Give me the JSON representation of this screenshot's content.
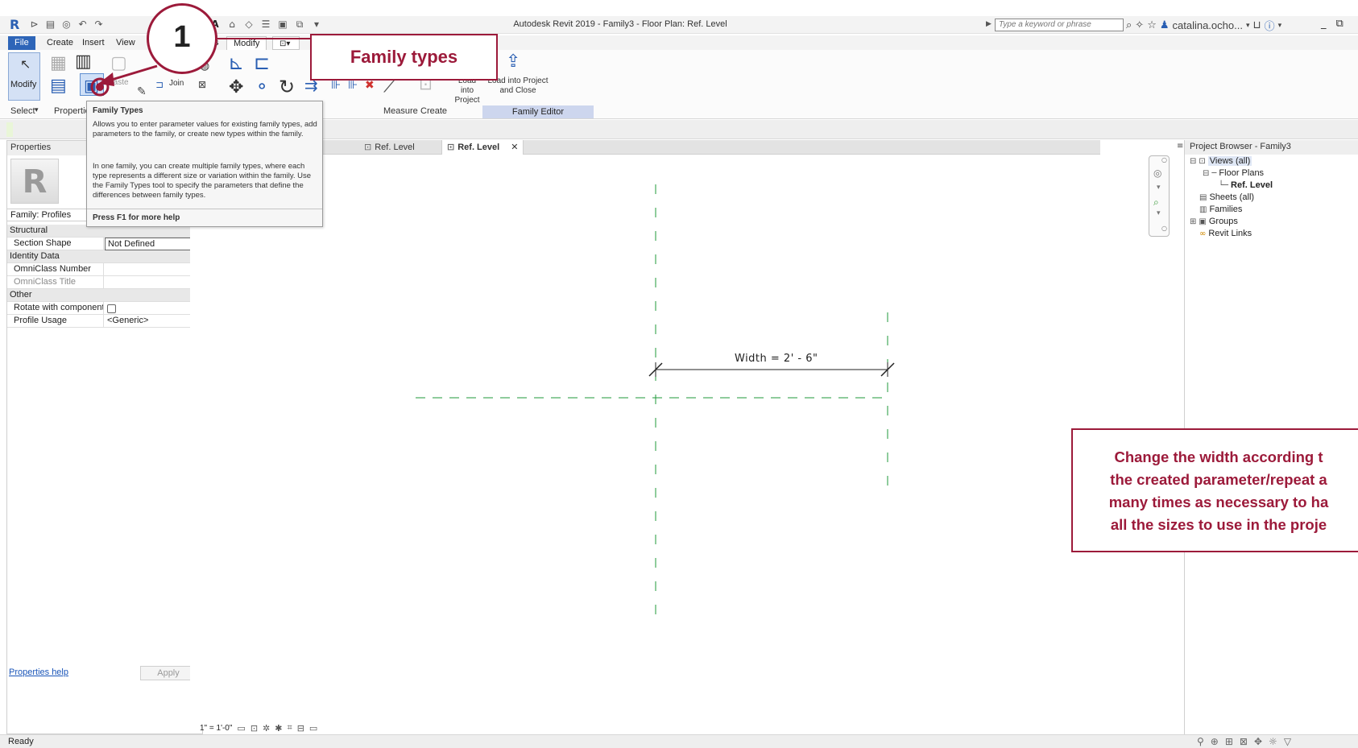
{
  "window": {
    "app_title": "Autodesk Revit 2019 - Family3 - Floor Plan: Ref. Level",
    "search_placeholder": "Type a keyword or phrase",
    "user_name": "catalina.ocho..."
  },
  "ribbon_tabs": {
    "file": "File",
    "create": "Create",
    "insert": "Insert",
    "view": "View",
    "modify_partial": "s",
    "modify": "Modify"
  },
  "ribbon": {
    "modify_label": "Modify",
    "paste_label": "Paste",
    "join_label": "Join",
    "load_into_project": "Load into Project",
    "load_into_project_close": "Load into Project and Close",
    "panel_select": "Select",
    "panel_properties": "Properties",
    "panel_measure": "Measure",
    "panel_create": "Create",
    "panel_family_editor": "Family Editor"
  },
  "tooltip": {
    "title": "Family Types",
    "paragraph1": "Allows you to enter parameter values for existing family types, add parameters to the family, or create new types within the family.",
    "paragraph2": "In one family, you can create multiple family types, where each type represents a different size or variation within the family. Use the Family Types tool to specify the parameters that define the differences between family types.",
    "help": "Press F1 for more help"
  },
  "properties": {
    "header": "Properties",
    "family": "Family: Profiles",
    "groups": [
      {
        "name": "Structural",
        "rows": [
          {
            "name": "Section Shape",
            "value": "Not Defined"
          }
        ]
      },
      {
        "name": "Identity Data",
        "rows": [
          {
            "name": "OmniClass Number",
            "value": ""
          },
          {
            "name": "OmniClass Title",
            "value": ""
          }
        ]
      },
      {
        "name": "Other",
        "rows": [
          {
            "name": "Rotate with component",
            "value": ""
          },
          {
            "name": "Profile Usage",
            "value": "<Generic>"
          }
        ]
      }
    ],
    "help_link": "Properties help",
    "apply": "Apply"
  },
  "view_tabs": {
    "tab1": "Ref. Level",
    "tab2": "Ref. Level"
  },
  "canvas": {
    "dimension_text": "Width = 2' - 6\""
  },
  "view_control": {
    "scale": "1\" = 1'-0\""
  },
  "project_browser": {
    "header": "Project Browser - Family3",
    "items": [
      "Views (all)",
      "Floor Plans",
      "Ref. Level",
      "Sheets (all)",
      "Families",
      "Groups",
      "Revit Links"
    ]
  },
  "status": {
    "ready": "Ready"
  },
  "annotations": {
    "step_number": "1",
    "family_types_label": "Family types",
    "note_line1": "Change the width according t",
    "note_line2": "the created parameter/repeat a",
    "note_line3": "many times as necessary to ha",
    "note_line4": "all the sizes to use in the proje",
    "accent_color": "#9c1a3a"
  }
}
